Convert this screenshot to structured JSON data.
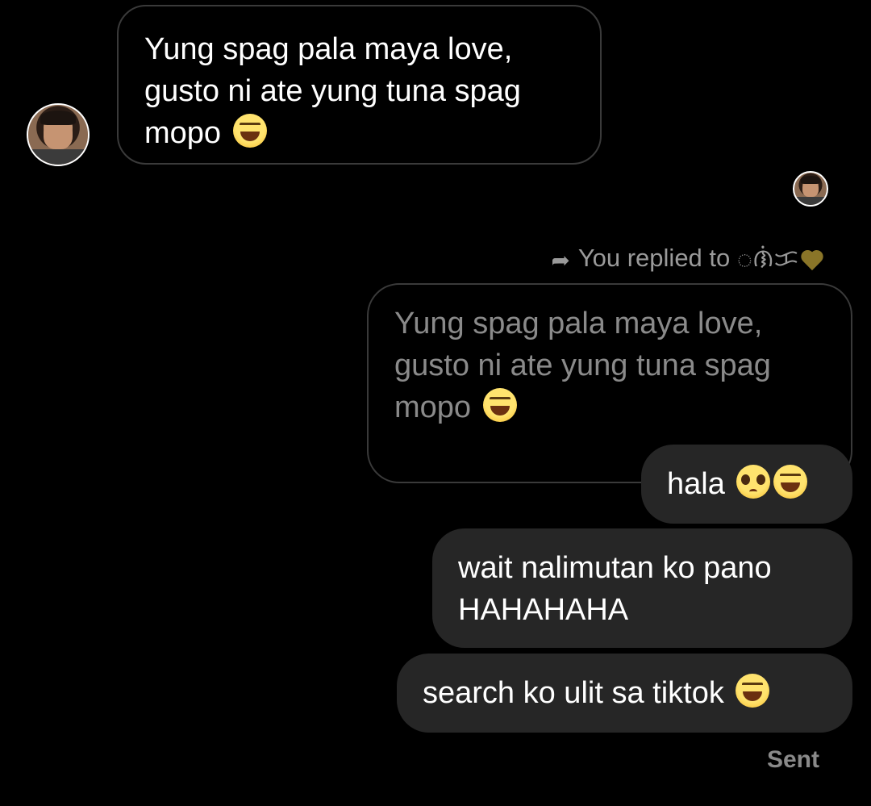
{
  "thread": {
    "incoming_message": {
      "lines": [
        "Yung spag pala maya love,",
        "gusto ni ate yung tuna spag",
        "mopo"
      ],
      "emoji": "laughing-emoji"
    },
    "reply_header": {
      "text": "You replied to ᜀᜈᜒᜃ",
      "icon": "reply-arrow-icon",
      "heart_color": "#8a7528"
    },
    "quoted_message": {
      "lines": [
        "Yung spag pala maya love,",
        "gusto ni ate yung tuna spag",
        "mopo"
      ],
      "emoji": "laughing-emoji"
    },
    "outgoing_messages": [
      {
        "text": "hala",
        "emojis": [
          "pleading-emoji",
          "laughing-emoji"
        ]
      },
      {
        "lines": [
          "wait nalimutan ko pano",
          "HAHAHAHA"
        ]
      },
      {
        "text": "search ko ulit sa tiktok",
        "emojis": [
          "laughing-emoji"
        ]
      }
    ],
    "status": "Sent"
  },
  "colors": {
    "background": "#000000",
    "outgoing_bubble": "#262626",
    "bubble_border": "#3a3a3a",
    "muted_text": "#8a8a8a"
  }
}
